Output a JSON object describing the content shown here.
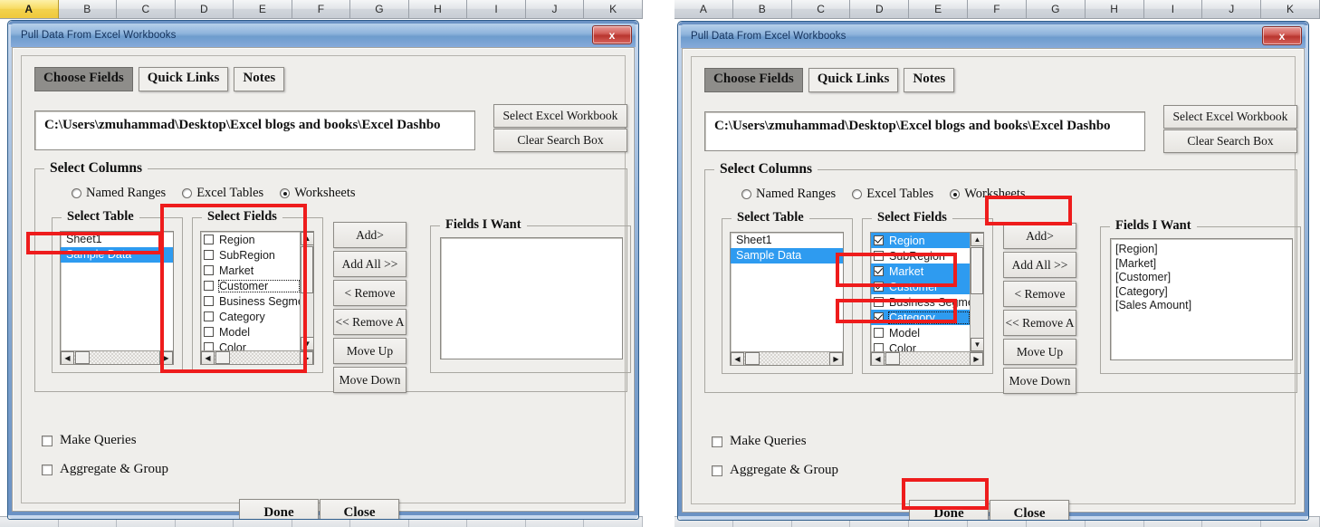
{
  "excel": {
    "columns": [
      "A",
      "B",
      "C",
      "D",
      "E",
      "F",
      "G",
      "H",
      "I",
      "J",
      "K"
    ],
    "selected_column": "A",
    "selected_column_color": "#f3d24e"
  },
  "dialog": {
    "title": "Pull Data From Excel Workbooks",
    "close_label": "x",
    "tabs": [
      {
        "label": "Choose Fields",
        "active": true
      },
      {
        "label": "Quick Links",
        "active": false
      },
      {
        "label": "Notes",
        "active": false
      }
    ],
    "search": {
      "value": "C:\\Users\\zmuhammad\\Desktop\\Excel blogs and books\\Excel Dashbo",
      "placeholder": ""
    },
    "side_buttons": [
      {
        "label": "Select Excel Workbook"
      },
      {
        "label": "Clear Search Box"
      }
    ],
    "select_columns_legend": "Select  Columns",
    "source_radios": [
      {
        "label": "Named Ranges",
        "selected": false
      },
      {
        "label": "Excel Tables",
        "selected": false
      },
      {
        "label": "Worksheets",
        "selected": true
      }
    ],
    "select_table": {
      "legend": "Select Table",
      "items": [
        {
          "label": "Sheet1",
          "selected": false
        },
        {
          "label": "Sample Data",
          "selected": true
        }
      ]
    },
    "select_fields": {
      "legend": "Select Fields"
    },
    "action_buttons": [
      {
        "label": "Add>"
      },
      {
        "label": "Add All >>"
      },
      {
        "label": "< Remove"
      },
      {
        "label": "<< Remove A"
      },
      {
        "label": "Move Up"
      },
      {
        "label": "Move Down"
      }
    ],
    "fields_i_want": {
      "legend": "Fields I Want"
    },
    "options": [
      {
        "label": "Make Queries",
        "checked": false
      },
      {
        "label": "Aggregate & Group",
        "checked": false
      }
    ],
    "footer_buttons": [
      {
        "label": "Done"
      },
      {
        "label": "Close"
      }
    ]
  },
  "left_panel": {
    "fields": [
      {
        "label": "Region",
        "checked": false,
        "selected": false,
        "focused": false
      },
      {
        "label": "SubRegion",
        "checked": false,
        "selected": false,
        "focused": false
      },
      {
        "label": "Market",
        "checked": false,
        "selected": false,
        "focused": false
      },
      {
        "label": "Customer",
        "checked": false,
        "selected": false,
        "focused": true
      },
      {
        "label": "Business Segmen",
        "checked": false,
        "selected": false,
        "focused": false
      },
      {
        "label": "Category",
        "checked": false,
        "selected": false,
        "focused": false
      },
      {
        "label": "Model",
        "checked": false,
        "selected": false,
        "focused": false
      },
      {
        "label": "Color",
        "checked": false,
        "selected": false,
        "focused": false
      }
    ],
    "fields_i_want_items": [],
    "annotations": [
      {
        "name": "sample-data-highlight"
      },
      {
        "name": "select-fields-highlight"
      }
    ]
  },
  "right_panel": {
    "fields": [
      {
        "label": "Region",
        "checked": true,
        "selected": true,
        "focused": false
      },
      {
        "label": "SubRegion",
        "checked": false,
        "selected": false,
        "focused": false
      },
      {
        "label": "Market",
        "checked": true,
        "selected": true,
        "focused": false
      },
      {
        "label": "Customer",
        "checked": true,
        "selected": true,
        "focused": false
      },
      {
        "label": "Business Segmen",
        "checked": false,
        "selected": false,
        "focused": false
      },
      {
        "label": "Category",
        "checked": true,
        "selected": true,
        "focused": true
      },
      {
        "label": "Model",
        "checked": false,
        "selected": false,
        "focused": false
      },
      {
        "label": "Color",
        "checked": false,
        "selected": false,
        "focused": false
      }
    ],
    "fields_i_want_items": [
      "[Region]",
      "[Market]",
      "[Customer]",
      "[Category]",
      "[Sales Amount]"
    ],
    "annotations": [
      {
        "name": "market-customer-highlight"
      },
      {
        "name": "category-highlight"
      },
      {
        "name": "add-button-highlight"
      },
      {
        "name": "done-button-highlight"
      }
    ]
  },
  "colors": {
    "annotation": "#ee1c1c",
    "list_selection": "#2e9bf0",
    "titlebar": "#8fb4dc",
    "close_button": "#b8352e"
  }
}
